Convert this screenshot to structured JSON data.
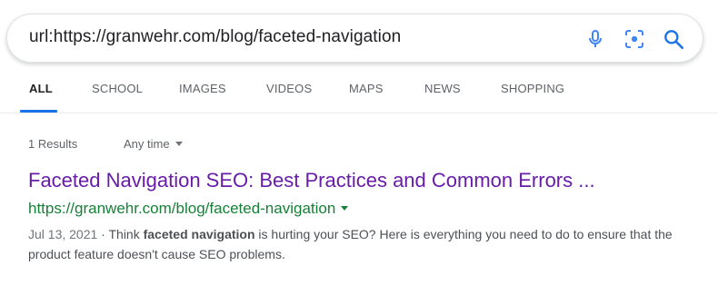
{
  "search": {
    "query": "url:https://granwehr.com/blog/faceted-navigation",
    "icons": [
      "microphone-icon",
      "lens-icon",
      "search-icon"
    ],
    "accent_color": "#1a73e8"
  },
  "tabs": [
    {
      "label": "ALL",
      "active": true
    },
    {
      "label": "SCHOOL",
      "active": false
    },
    {
      "label": "IMAGES",
      "active": false
    },
    {
      "label": "VIDEOS",
      "active": false
    },
    {
      "label": "MAPS",
      "active": false
    },
    {
      "label": "NEWS",
      "active": false
    },
    {
      "label": "SHOPPING",
      "active": false
    }
  ],
  "toolbar": {
    "results_count": "1 Results",
    "time_filter": "Any time"
  },
  "result": {
    "title": "Faceted Navigation SEO: Best Practices and Common Errors ...",
    "url": "https://granwehr.com/blog/faceted-navigation",
    "date": "Jul 13, 2021",
    "snippet_before": " · Think ",
    "snippet_bold": "faceted navigation",
    "snippet_after": " is hurting your SEO? Here is everything you need to do to ensure that the product feature doesn't cause SEO problems.",
    "title_color": "#681da8",
    "url_color": "#188038"
  }
}
